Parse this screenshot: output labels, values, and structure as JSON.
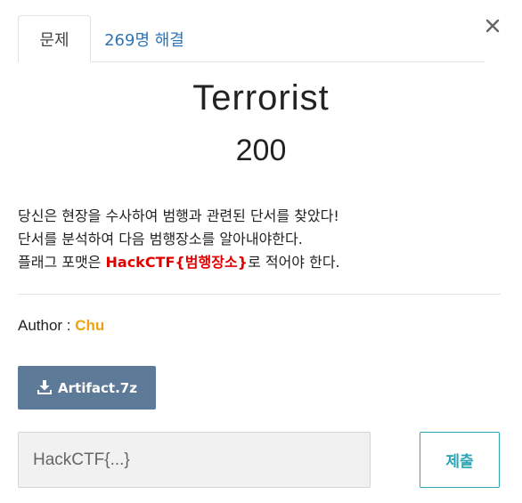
{
  "tabs": {
    "problem_label": "문제",
    "solvers_label": "269명 해결"
  },
  "challenge": {
    "title": "Terrorist",
    "points": "200",
    "description": [
      "당신은 현장을 수사하여 범행과 관련된 단서를 찾았다!",
      "단서를 분석하여 다음 범행장소를 알아내야한다.",
      {
        "prefix": "플래그 포맷은 ",
        "highlight": "HackCTF{범행장소}",
        "suffix": "로 적어야 한다."
      }
    ]
  },
  "author": {
    "label": "Author : ",
    "name": "Chu"
  },
  "download": {
    "label": "Artifact.7z",
    "icon": "download-icon"
  },
  "flag_form": {
    "placeholder": "HackCTF{...}",
    "value": "",
    "submit_label": "제출"
  },
  "colors": {
    "solvers_tab": "#2f75b5",
    "flag_highlight": "#e00000",
    "author_name": "#f0a30a",
    "download_bg": "#5e7a99",
    "submit_accent": "#2ca5b5"
  }
}
